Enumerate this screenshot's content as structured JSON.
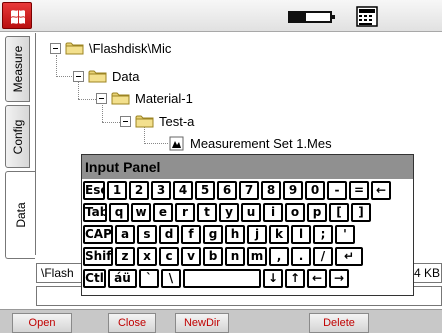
{
  "status_bar": {
    "battery_level": 0.4
  },
  "side_tabs": [
    "Measure",
    "Config",
    "Data"
  ],
  "tree": {
    "root": "\\Flashdisk\\Mic",
    "level1": "Data",
    "level2": "Material-1",
    "level3": "Test-a",
    "file": "Measurement Set 1.Mes"
  },
  "input_panel": {
    "title": "Input Panel",
    "rows": [
      [
        "Esc",
        "1",
        "2",
        "3",
        "4",
        "5",
        "6",
        "7",
        "8",
        "9",
        "0",
        "-",
        "=",
        "←"
      ],
      [
        "Tab",
        "q",
        "w",
        "e",
        "r",
        "t",
        "y",
        "u",
        "i",
        "o",
        "p",
        "[",
        "]"
      ],
      [
        "CAP",
        "a",
        "s",
        "d",
        "f",
        "g",
        "h",
        "j",
        "k",
        "l",
        ";",
        "'"
      ],
      [
        "Shift",
        "z",
        "x",
        "c",
        "v",
        "b",
        "n",
        "m",
        ",",
        ".",
        "/",
        "↵"
      ],
      [
        "Ctl",
        "áü",
        "`",
        "\\",
        " ",
        "↓",
        "↑",
        "←",
        "→"
      ]
    ]
  },
  "path_field": "\\Flash",
  "size_label": "4 KB",
  "buttons": {
    "open": "Open",
    "close": "Close",
    "newdir": "NewDir",
    "delete": "Delete"
  },
  "colors": {
    "start_red": "#c81a1a",
    "panel_title": "#909090",
    "button_text": "#c00000"
  }
}
